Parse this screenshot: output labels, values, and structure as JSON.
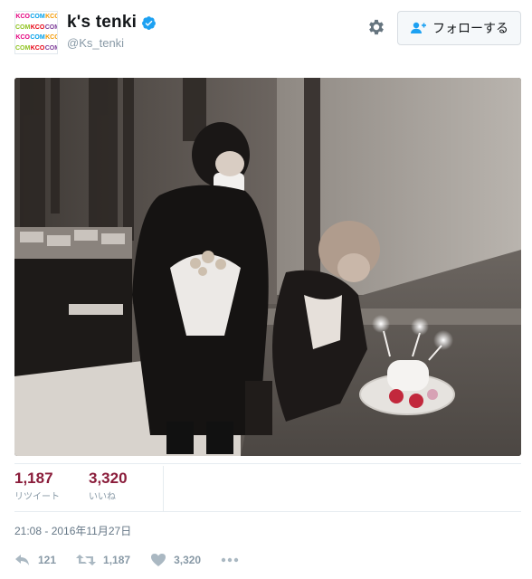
{
  "user": {
    "display_name": "k's tenki",
    "handle": "@Ks_tenki",
    "verified": true,
    "avatar_text": [
      "KCO",
      "COM",
      "KCO",
      "COM",
      "KCO",
      "COM",
      "KCO",
      "COM",
      "KCO",
      "COM",
      "KCO",
      "COM"
    ]
  },
  "actions": {
    "follow_label": "フォローする",
    "settings_icon": "gear-icon",
    "follow_icon": "add-user-icon"
  },
  "stats": {
    "retweets": {
      "value": "1,187",
      "label": "リツイート"
    },
    "likes": {
      "value": "3,320",
      "label": "いいね"
    }
  },
  "timestamp": "21:08 - 2016年11月27日",
  "footer": {
    "reply_count": "121",
    "retweet_count": "1,187",
    "like_count": "3,320"
  },
  "colors": {
    "accent": "#1da1f2",
    "stat_number": "#8a1c3a",
    "muted": "#8899a6"
  }
}
